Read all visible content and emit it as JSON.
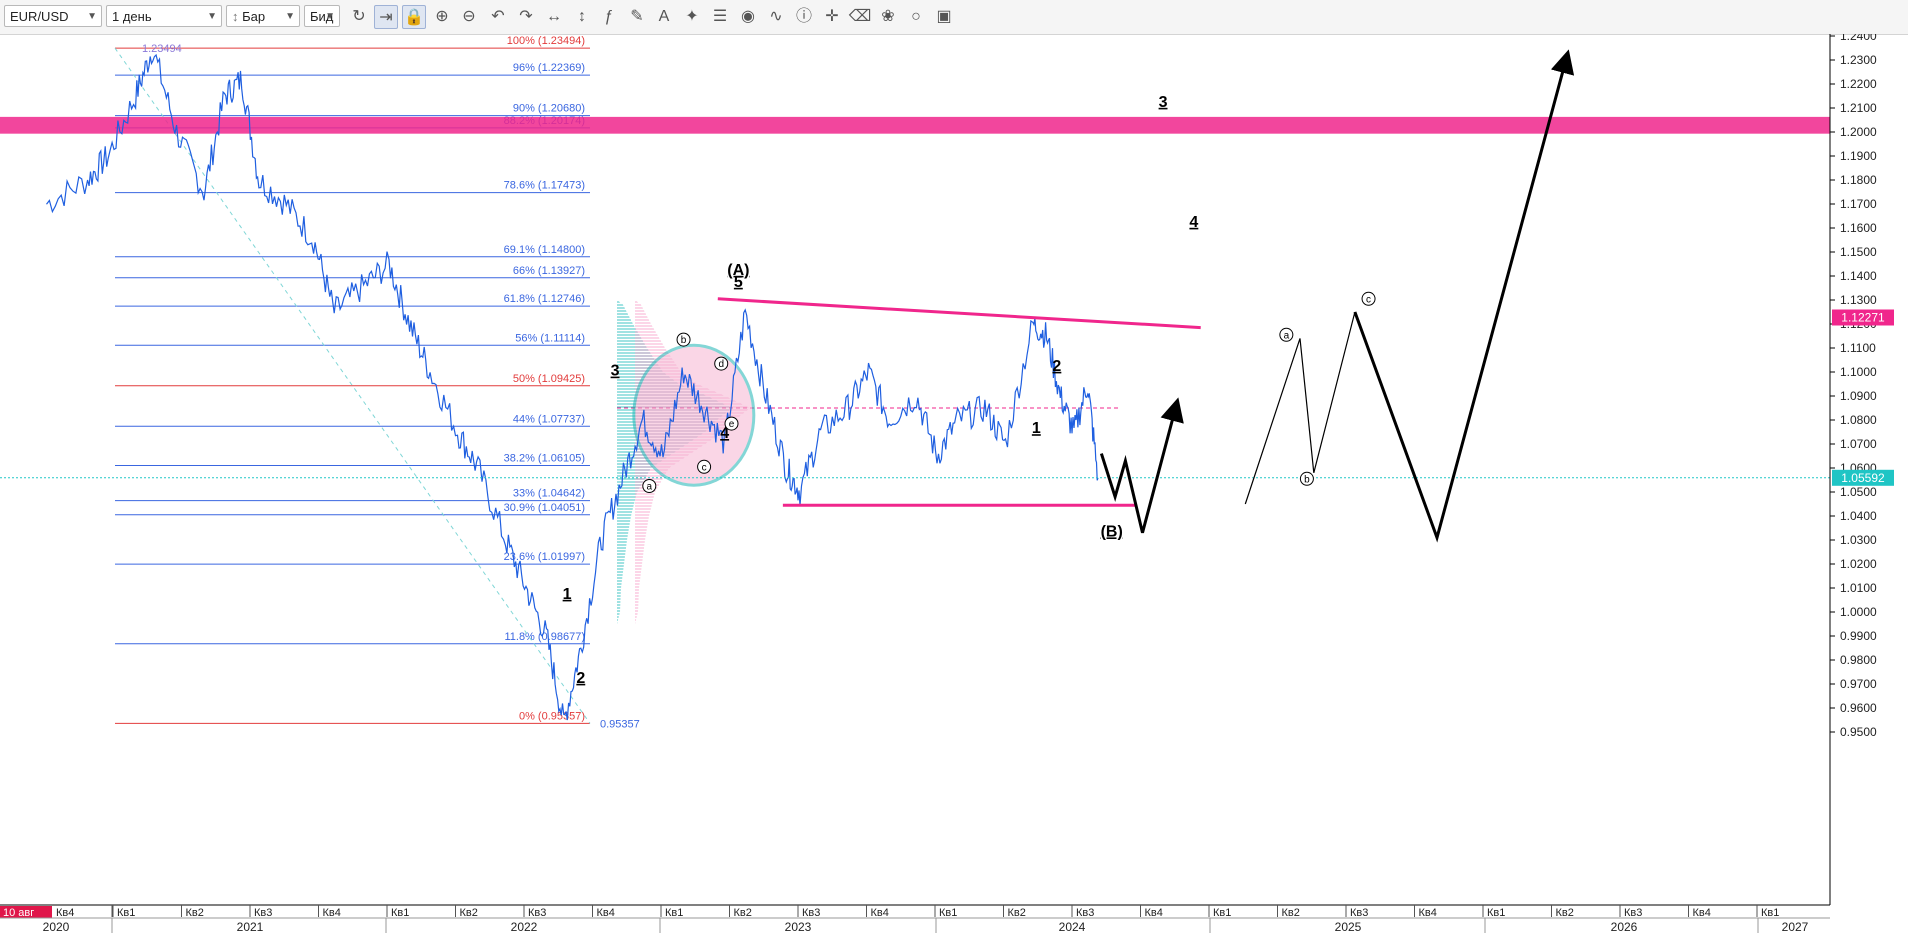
{
  "toolbar": {
    "symbol": "EUR/USD",
    "timeframe": "1 день",
    "chart_type": "Бар",
    "price_type": "Бид",
    "icons": [
      "refresh-icon",
      "autoscroll-icon",
      "lock-icon",
      "zoom-in-icon",
      "zoom-out-icon",
      "undo-icon",
      "redo-icon",
      "horizontal-scale-icon",
      "vertical-scale-icon",
      "indicator-fx-icon",
      "pencil-icon",
      "text-tool-icon",
      "crosshair-icon",
      "layers-icon",
      "eye-icon",
      "wave-icon",
      "info-icon",
      "cursor-icon",
      "eraser-icon",
      "paint-icon",
      "circle-icon",
      "save-icon"
    ]
  },
  "colors": {
    "price_line": "#1f5fe0",
    "fib_line": "#3a66e0",
    "fib_red": "#e23b3b",
    "pink": "#f0268c",
    "teal": "#1fb5b5",
    "current_price_bg": "#1fc5c5",
    "marker_price_bg": "#f0268c"
  },
  "chart_data": {
    "type": "line",
    "symbol": "EUR/USD",
    "y_axis": {
      "ylim": [
        0.945,
        1.245
      ],
      "ticks": [
        "1.2400",
        "1.2300",
        "1.2200",
        "1.2100",
        "1.2000",
        "1.1900",
        "1.1800",
        "1.1700",
        "1.1600",
        "1.1500",
        "1.1400",
        "1.1300",
        "1.1200",
        "1.1100",
        "1.1000",
        "1.0900",
        "1.0800",
        "1.0700",
        "1.0600",
        "1.0500",
        "1.0400",
        "1.0300",
        "1.0200",
        "1.0100",
        "1.0000",
        "0.9900",
        "0.9800",
        "0.9700",
        "0.9600",
        "0.9500"
      ]
    },
    "x_axis": {
      "start_label": "10 авг",
      "quarters": [
        "Кв4",
        "Кв1",
        "Кв2",
        "Кв3",
        "Кв4",
        "Кв1",
        "Кв2",
        "Кв3",
        "Кв4",
        "Кв1",
        "Кв2",
        "Кв3",
        "Кв4",
        "Кв1",
        "Кв2",
        "Кв3",
        "Кв4",
        "Кв1",
        "Кв2",
        "Кв3",
        "Кв4",
        "Кв1",
        "Кв2",
        "Кв3",
        "Кв4",
        "Кв1"
      ],
      "years": [
        "2020",
        "2021",
        "2022",
        "2023",
        "2024",
        "2025",
        "2026",
        "2027"
      ]
    },
    "price_labels": {
      "current": "1.05592",
      "marker": "1.12271",
      "high": "1.23494",
      "low": "0.95357"
    },
    "series": [
      {
        "values_anchor_points": [
          {
            "q": 0.0,
            "y": 1.17
          },
          {
            "q": 0.6,
            "y": 1.18
          },
          {
            "q": 0.9,
            "y": 1.19
          },
          {
            "q": 1.3,
            "y": 1.215
          },
          {
            "q": 1.55,
            "y": 1.2349
          },
          {
            "q": 1.9,
            "y": 1.2
          },
          {
            "q": 2.3,
            "y": 1.175
          },
          {
            "q": 2.6,
            "y": 1.215
          },
          {
            "q": 2.85,
            "y": 1.222
          },
          {
            "q": 3.1,
            "y": 1.18
          },
          {
            "q": 3.5,
            "y": 1.17
          },
          {
            "q": 3.9,
            "y": 1.155
          },
          {
            "q": 4.2,
            "y": 1.125
          },
          {
            "q": 4.6,
            "y": 1.135
          },
          {
            "q": 5.0,
            "y": 1.145
          },
          {
            "q": 5.3,
            "y": 1.12
          },
          {
            "q": 5.6,
            "y": 1.1
          },
          {
            "q": 6.0,
            "y": 1.075
          },
          {
            "q": 6.3,
            "y": 1.06
          },
          {
            "q": 6.7,
            "y": 1.03
          },
          {
            "q": 7.0,
            "y": 1.01
          },
          {
            "q": 7.3,
            "y": 0.99
          },
          {
            "q": 7.55,
            "y": 0.9536
          },
          {
            "q": 7.8,
            "y": 0.985
          },
          {
            "q": 8.1,
            "y": 1.03
          },
          {
            "q": 8.4,
            "y": 1.055
          },
          {
            "q": 8.7,
            "y": 1.08
          },
          {
            "q": 9.0,
            "y": 1.065
          },
          {
            "q": 9.3,
            "y": 1.1
          },
          {
            "q": 9.6,
            "y": 1.085
          },
          {
            "q": 9.9,
            "y": 1.07
          },
          {
            "q": 10.2,
            "y": 1.125
          },
          {
            "q": 10.5,
            "y": 1.09
          },
          {
            "q": 10.8,
            "y": 1.06
          },
          {
            "q": 11.0,
            "y": 1.05
          },
          {
            "q": 11.3,
            "y": 1.075
          },
          {
            "q": 11.7,
            "y": 1.085
          },
          {
            "q": 12.0,
            "y": 1.1
          },
          {
            "q": 12.3,
            "y": 1.08
          },
          {
            "q": 12.7,
            "y": 1.09
          },
          {
            "q": 13.0,
            "y": 1.065
          },
          {
            "q": 13.3,
            "y": 1.08
          },
          {
            "q": 13.7,
            "y": 1.085
          },
          {
            "q": 14.0,
            "y": 1.07
          },
          {
            "q": 14.4,
            "y": 1.12
          },
          {
            "q": 14.6,
            "y": 1.115
          },
          {
            "q": 14.8,
            "y": 1.09
          },
          {
            "q": 15.0,
            "y": 1.075
          },
          {
            "q": 15.2,
            "y": 1.095
          },
          {
            "q": 15.35,
            "y": 1.0559
          }
        ]
      }
    ],
    "fibonacci": [
      {
        "label": "100% (1.23494)",
        "value": 1.23494,
        "red": true
      },
      {
        "label": "96% (1.22369)",
        "value": 1.22369
      },
      {
        "label": "90% (1.20680)",
        "value": 1.2068
      },
      {
        "label": "88.2% (1.20174)",
        "value": 1.20174
      },
      {
        "label": "78.6% (1.17473)",
        "value": 1.17473
      },
      {
        "label": "69.1% (1.14800)",
        "value": 1.148
      },
      {
        "label": "66% (1.13927)",
        "value": 1.13927
      },
      {
        "label": "61.8% (1.12746)",
        "value": 1.12746
      },
      {
        "label": "56% (1.11114)",
        "value": 1.11114
      },
      {
        "label": "50% (1.09425)",
        "value": 1.09425,
        "red": true
      },
      {
        "label": "44% (1.07737)",
        "value": 1.07737
      },
      {
        "label": "38.2% (1.06105)",
        "value": 1.06105
      },
      {
        "label": "33% (1.04642)",
        "value": 1.04642
      },
      {
        "label": "30.9% (1.04051)",
        "value": 1.04051
      },
      {
        "label": "23.6% (1.01997)",
        "value": 1.01997
      },
      {
        "label": "11.8% (0.98677)",
        "value": 0.98677
      },
      {
        "label": "0% (0.95357)",
        "value": 0.95357,
        "red": true
      }
    ],
    "wave_labels": [
      {
        "text": "(A)",
        "q": 10.1,
        "y": 1.1405
      },
      {
        "text": "5",
        "q": 10.1,
        "y": 1.1355
      },
      {
        "text": "3",
        "q": 8.3,
        "y": 1.0985
      },
      {
        "text": "4",
        "q": 9.9,
        "y": 1.0725
      },
      {
        "text": "1",
        "q": 7.6,
        "y": 1.0055
      },
      {
        "text": "2",
        "q": 7.8,
        "y": 0.9705
      },
      {
        "text": "2",
        "q": 14.75,
        "y": 1.1005
      },
      {
        "text": "1",
        "q": 14.45,
        "y": 1.0745
      },
      {
        "text": "(B)",
        "q": 15.55,
        "y": 1.0315
      },
      {
        "text": "3",
        "q": 16.3,
        "y": 1.2105
      },
      {
        "text": "4",
        "q": 16.75,
        "y": 1.1605
      }
    ],
    "subwave_labels": [
      {
        "text": "a",
        "q": 8.8,
        "y": 1.0525
      },
      {
        "text": "b",
        "q": 9.3,
        "y": 1.1135
      },
      {
        "text": "c",
        "q": 9.6,
        "y": 1.0605
      },
      {
        "text": "d",
        "q": 9.85,
        "y": 1.1035
      },
      {
        "text": "e",
        "q": 10.0,
        "y": 1.0785
      },
      {
        "text": "a",
        "q": 18.1,
        "y": 1.1155
      },
      {
        "text": "b",
        "q": 18.4,
        "y": 1.0555
      },
      {
        "text": "c",
        "q": 19.3,
        "y": 1.1305
      }
    ],
    "projection_thick": [
      {
        "q": 15.4,
        "y": 1.066
      },
      {
        "q": 15.6,
        "y": 1.048
      },
      {
        "q": 15.75,
        "y": 1.063
      },
      {
        "q": 16.0,
        "y": 1.033
      },
      {
        "q": 16.5,
        "y": 1.087
      }
    ],
    "projection_thin": [
      {
        "q": 17.5,
        "y": 1.045
      },
      {
        "q": 18.3,
        "y": 1.114
      },
      {
        "q": 18.5,
        "y": 1.058
      },
      {
        "q": 19.1,
        "y": 1.125
      }
    ],
    "projection_big": [
      {
        "q": 19.1,
        "y": 1.125
      },
      {
        "q": 20.3,
        "y": 1.031
      },
      {
        "q": 22.2,
        "y": 1.232
      }
    ]
  }
}
